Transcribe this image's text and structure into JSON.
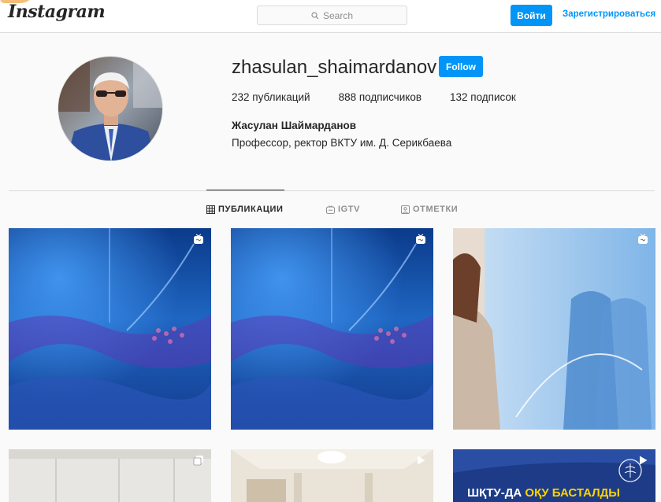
{
  "header": {
    "logo": "Instagram",
    "search_placeholder": "Search",
    "login_label": "Войти",
    "signup_label": "Зарегистрироваться"
  },
  "profile": {
    "username": "zhasulan_shaimardanov",
    "follow_label": "Follow",
    "stats": {
      "posts": "232 публикаций",
      "followers": "888 подписчиков",
      "following": "132 подписок"
    },
    "full_name": "Жасулан Шаймарданов",
    "bio": "Профессор, ректор ВКТУ им. Д. Серикбаева"
  },
  "tabs": [
    {
      "label": "ПУБЛИКАЦИИ",
      "icon": "grid-icon",
      "active": true
    },
    {
      "label": "IGTV",
      "icon": "igtv-icon",
      "active": false
    },
    {
      "label": "ОТМЕТКИ",
      "icon": "tagged-icon",
      "active": false
    }
  ],
  "posts": [
    {
      "type": "igtv",
      "badge": "igtv-badge-icon"
    },
    {
      "type": "igtv",
      "badge": "igtv-badge-icon"
    },
    {
      "type": "igtv",
      "badge": "igtv-badge-icon"
    },
    {
      "type": "carousel",
      "badge": "carousel-badge-icon"
    },
    {
      "type": "video",
      "badge": "play-badge-icon"
    },
    {
      "type": "video",
      "badge": "play-badge-icon",
      "caption_main": "ШҚТУ-ДА ",
      "caption_highlight": "ОҚУ БАСТАЛДЫ"
    }
  ],
  "colors": {
    "accent": "#0095f6",
    "text": "#262626",
    "muted": "#8e8e8e",
    "border": "#dbdbdb",
    "background": "#fafafa"
  }
}
